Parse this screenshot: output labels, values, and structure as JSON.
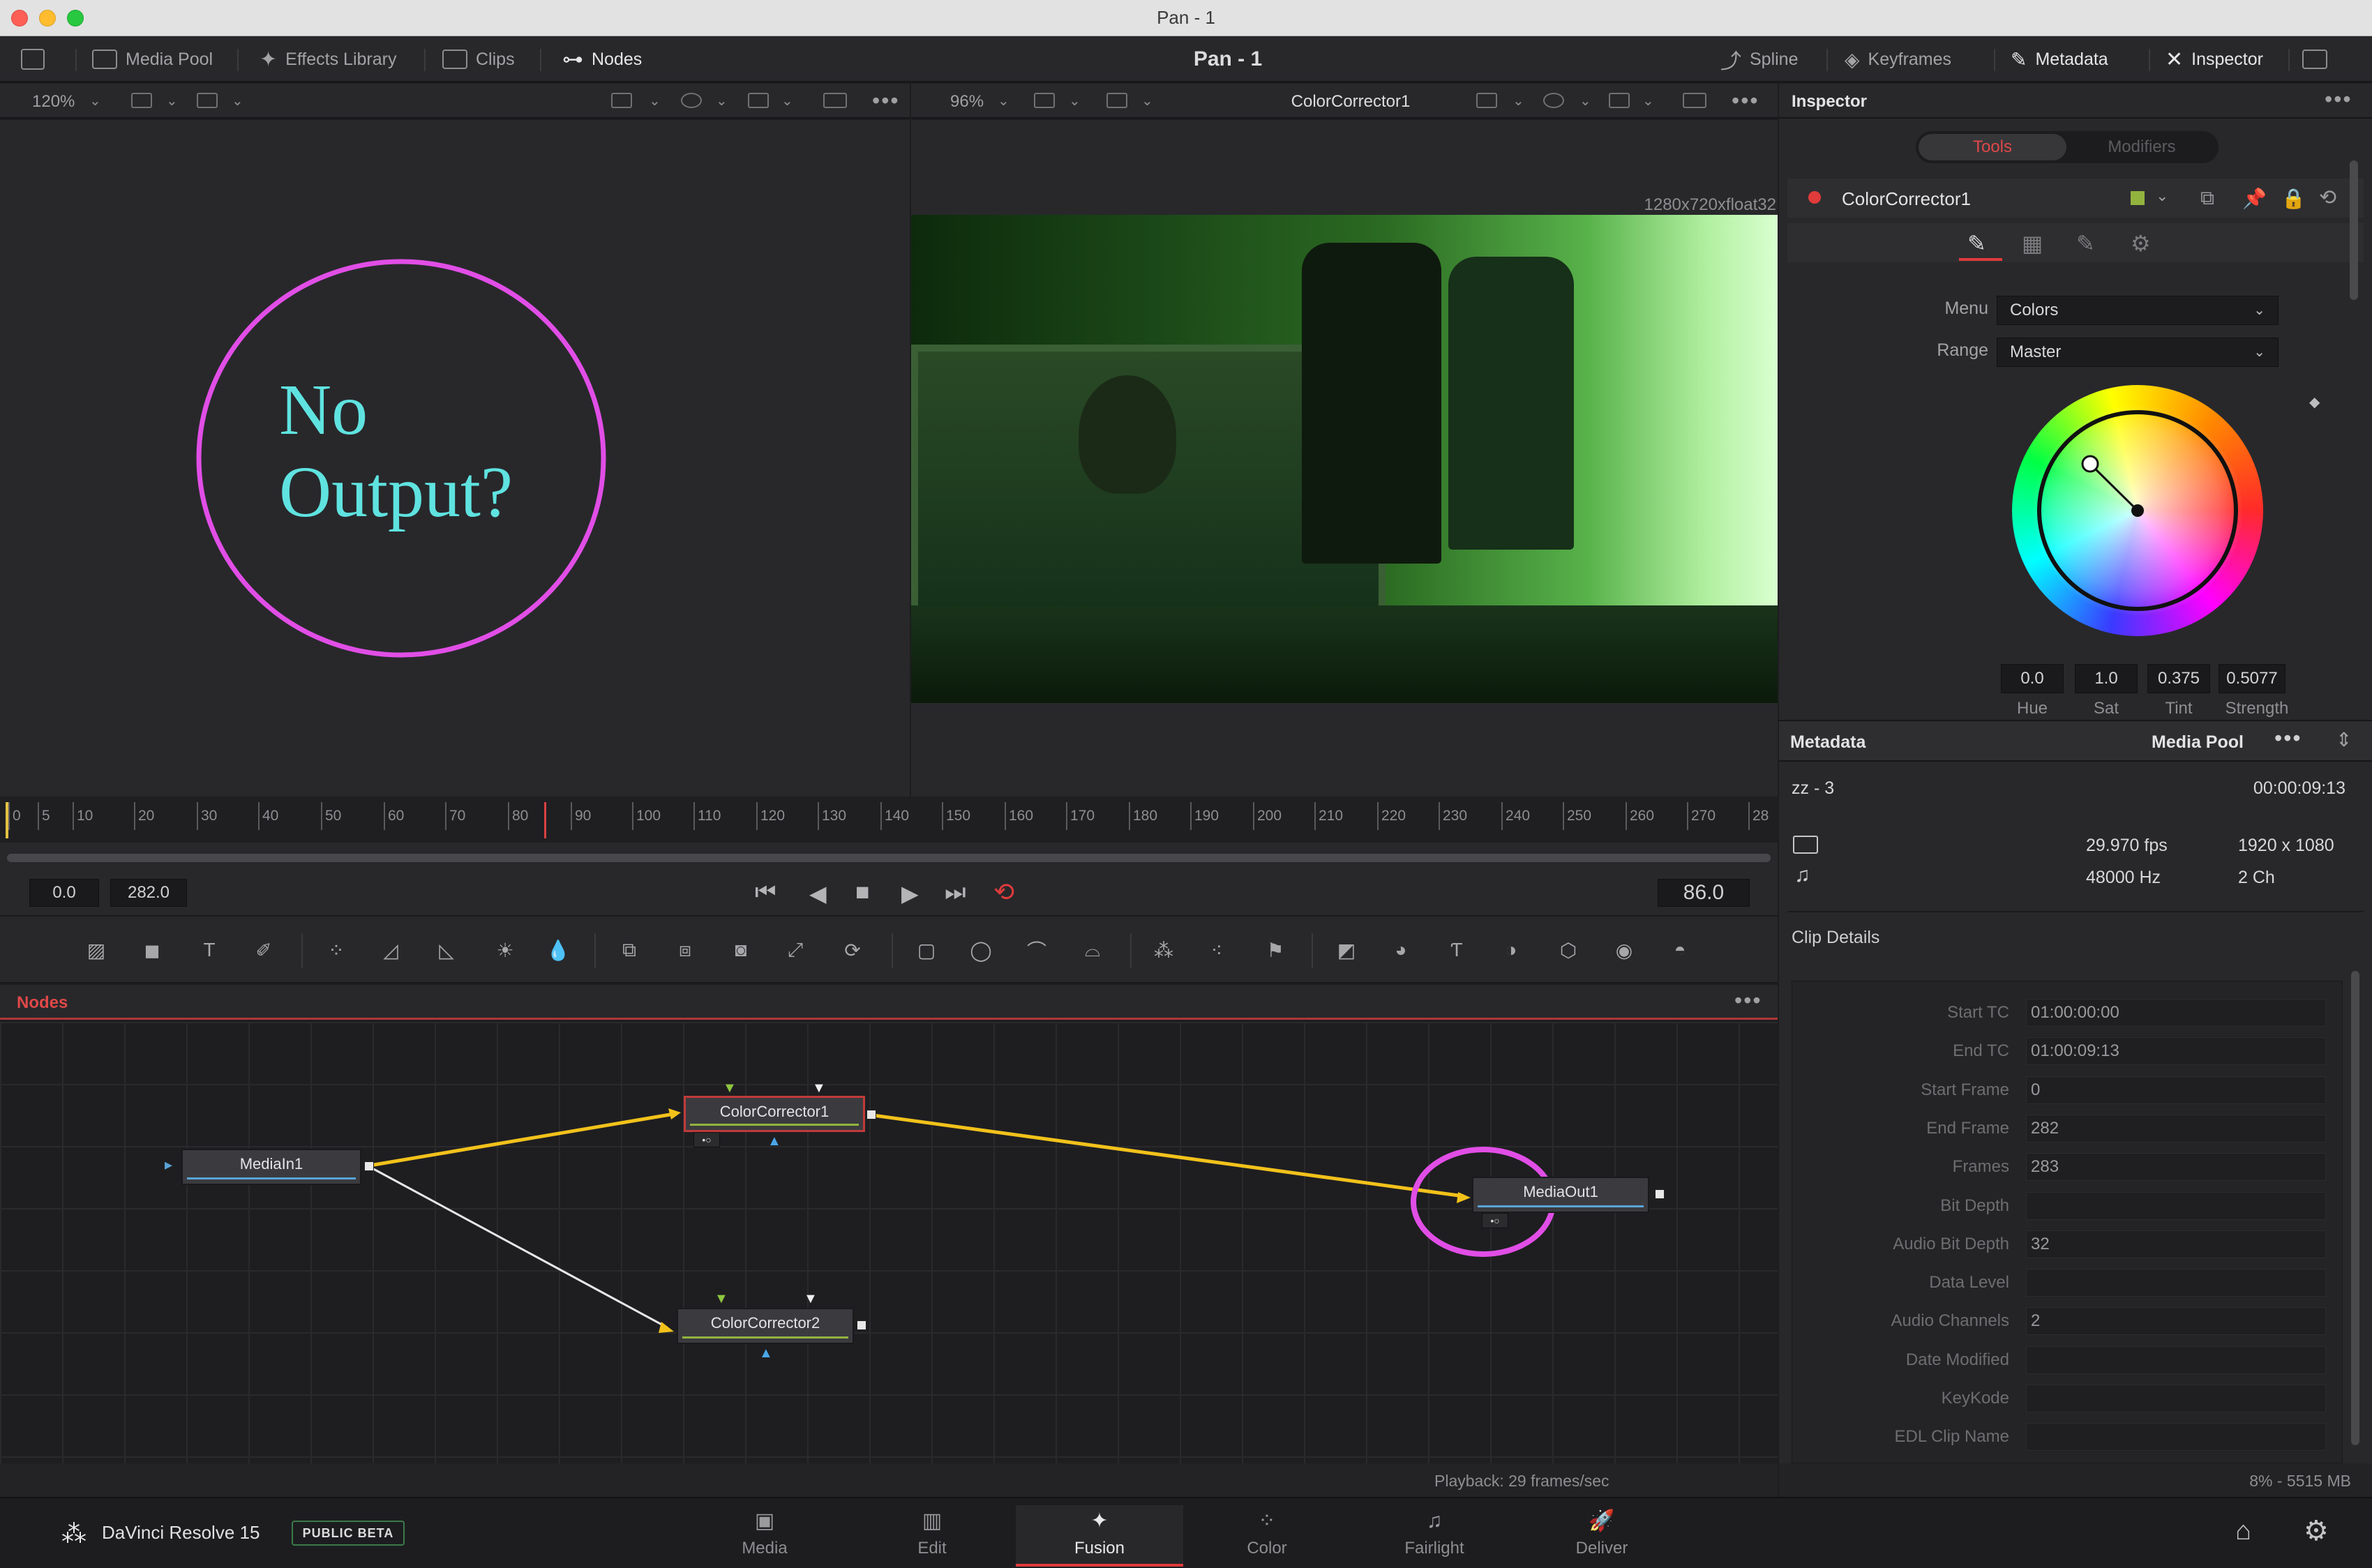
{
  "window": {
    "title": "Pan - 1"
  },
  "menubar": {
    "media_pool": "Media Pool",
    "effects_library": "Effects Library",
    "clips": "Clips",
    "nodes": "Nodes",
    "center_title": "Pan - 1",
    "spline": "Spline",
    "keyframes": "Keyframes",
    "metadata": "Metadata",
    "inspector": "Inspector"
  },
  "viewer_left": {
    "zoom": "120%",
    "overlay_text_line1": "No",
    "overlay_text_line2": "Output?"
  },
  "viewer_right": {
    "zoom": "96%",
    "node_name": "ColorCorrector1",
    "resolution": "1280x720xfloat32"
  },
  "ruler": {
    "ticks": [
      "0",
      "5",
      "10",
      "20",
      "30",
      "40",
      "50",
      "60",
      "70",
      "80",
      "90",
      "100",
      "110",
      "120",
      "130",
      "140",
      "150",
      "160",
      "170",
      "180",
      "190",
      "200",
      "210",
      "220",
      "230",
      "240",
      "250",
      "260",
      "270",
      "28"
    ]
  },
  "transport": {
    "start": "0.0",
    "end": "282.0",
    "current": "86.0"
  },
  "nodes_panel": {
    "title": "Nodes",
    "nodes": {
      "media_in": "MediaIn1",
      "cc1": "ColorCorrector1",
      "cc2": "ColorCorrector2",
      "media_out": "MediaOut1"
    }
  },
  "status": {
    "playback": "Playback: 29 frames/sec",
    "memory": "8% - 5515 MB"
  },
  "inspector": {
    "title": "Inspector",
    "tab_tools": "Tools",
    "tab_modifiers": "Modifiers",
    "tool_name": "ColorCorrector1",
    "menu_label": "Menu",
    "menu_value": "Colors",
    "range_label": "Range",
    "range_value": "Master",
    "values": {
      "hue": "0.0",
      "sat": "1.0",
      "tint": "0.375",
      "strength": "0.5077"
    },
    "value_labels": {
      "hue": "Hue",
      "sat": "Sat",
      "tint": "Tint",
      "strength": "Strength"
    }
  },
  "metadata": {
    "title": "Metadata",
    "source": "Media Pool",
    "clip_name": "zz - 3",
    "duration": "00:00:09:13",
    "fps": "29.970 fps",
    "resolution": "1920 x 1080",
    "audio_rate": "48000 Hz",
    "channels": "2 Ch",
    "details_title": "Clip Details",
    "details": [
      {
        "key": "Start TC",
        "value": "01:00:00:00"
      },
      {
        "key": "End TC",
        "value": "01:00:09:13"
      },
      {
        "key": "Start Frame",
        "value": "0"
      },
      {
        "key": "End Frame",
        "value": "282"
      },
      {
        "key": "Frames",
        "value": "283"
      },
      {
        "key": "Bit Depth",
        "value": ""
      },
      {
        "key": "Audio Bit Depth",
        "value": "32"
      },
      {
        "key": "Data Level",
        "value": ""
      },
      {
        "key": "Audio Channels",
        "value": "2"
      },
      {
        "key": "Date Modified",
        "value": ""
      },
      {
        "key": "KeyKode",
        "value": ""
      },
      {
        "key": "EDL Clip Name",
        "value": ""
      }
    ]
  },
  "pagebar": {
    "app_name": "DaVinci Resolve 15",
    "beta_badge": "PUBLIC BETA",
    "pages": [
      "Media",
      "Edit",
      "Fusion",
      "Color",
      "Fairlight",
      "Deliver"
    ]
  },
  "colors": {
    "accent_red": "#e03b3b",
    "annotation_magenta": "#e14ee6",
    "overlay_cyan": "#5fe3e0",
    "link_yellow": "#f2c21b"
  }
}
